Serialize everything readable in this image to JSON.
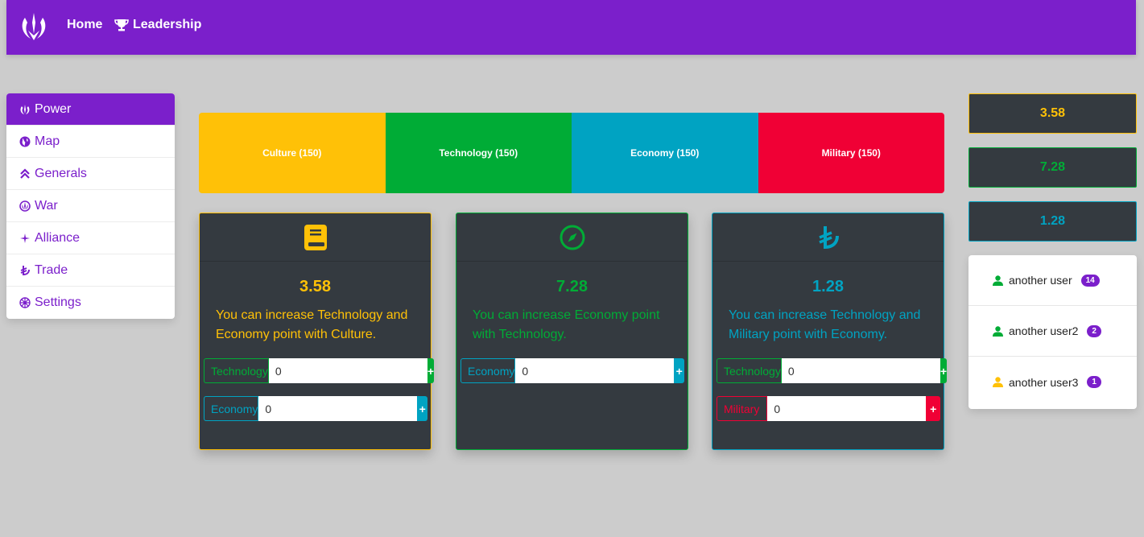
{
  "colors": {
    "brand": "#7b1fcb",
    "culture": "#ffc107",
    "technology": "#00ac36",
    "economy": "#00a3c2",
    "military": "#f00035",
    "card_bg": "#343a40"
  },
  "nav": {
    "home": "Home",
    "leadership": "Leadership"
  },
  "sidebar": {
    "items": [
      {
        "label": "Power",
        "icon": "power-icon"
      },
      {
        "label": "Map",
        "icon": "globe-icon"
      },
      {
        "label": "Generals",
        "icon": "chevrons-up-icon"
      },
      {
        "label": "War",
        "icon": "war-icon"
      },
      {
        "label": "Alliance",
        "icon": "alliance-icon"
      },
      {
        "label": "Trade",
        "icon": "lira-icon"
      },
      {
        "label": "Settings",
        "icon": "settings-icon"
      }
    ]
  },
  "stats": [
    {
      "label": "Culture (150)"
    },
    {
      "label": "Technology (150)"
    },
    {
      "label": "Economy (150)"
    },
    {
      "label": "Military (150)"
    }
  ],
  "cards": [
    {
      "icon": "book-icon",
      "value": "3.58",
      "text": "You can increase Technology and Economy point with Culture.",
      "rows": [
        {
          "label": "Technology",
          "value": "0",
          "button": "+"
        },
        {
          "label": "Economy",
          "value": "0",
          "button": "+"
        }
      ]
    },
    {
      "icon": "compass-icon",
      "value": "7.28",
      "text": "You can increase Economy point with Technology.",
      "rows": [
        {
          "label": "Economy",
          "value": "0",
          "button": "+"
        }
      ]
    },
    {
      "icon": "lira-icon",
      "value": "1.28",
      "text": "You can increase Technology and Military point with Economy.",
      "rows": [
        {
          "label": "Technology",
          "value": "0",
          "button": "+"
        },
        {
          "label": "Military",
          "value": "0",
          "button": "+"
        }
      ]
    }
  ],
  "mini_stats": [
    "3.58",
    "7.28",
    "1.28"
  ],
  "users": [
    {
      "name": "another user",
      "count": "14"
    },
    {
      "name": "another user2",
      "count": "2"
    },
    {
      "name": "another user3",
      "count": "1"
    }
  ]
}
